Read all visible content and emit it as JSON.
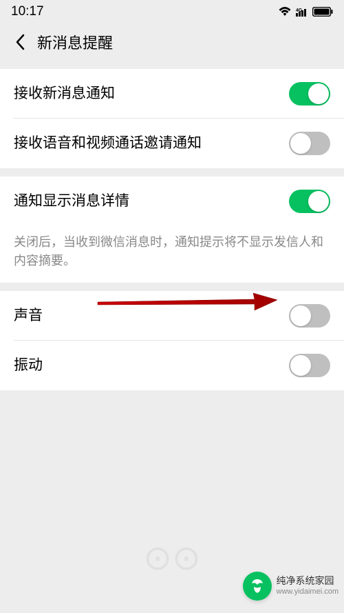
{
  "status_bar": {
    "time": "10:17"
  },
  "header": {
    "title": "新消息提醒"
  },
  "section1": {
    "item1": {
      "label": "接收新消息通知",
      "toggle": true
    },
    "item2": {
      "label": "接收语音和视频通话邀请通知",
      "toggle": false
    }
  },
  "section2": {
    "item1": {
      "label": "通知显示消息详情",
      "toggle": true
    },
    "desc": "关闭后，当收到微信消息时，通知提示将不显示发信人和内容摘要。"
  },
  "section3": {
    "item1": {
      "label": "声音",
      "toggle": false
    },
    "item2": {
      "label": "振动",
      "toggle": false
    }
  },
  "watermark": {
    "brand": "纯净系统家园",
    "url": "www.yidaimei.com"
  },
  "colors": {
    "toggle_on": "#07c160",
    "toggle_off": "#bfbfbf",
    "arrow": "#cc0000"
  }
}
